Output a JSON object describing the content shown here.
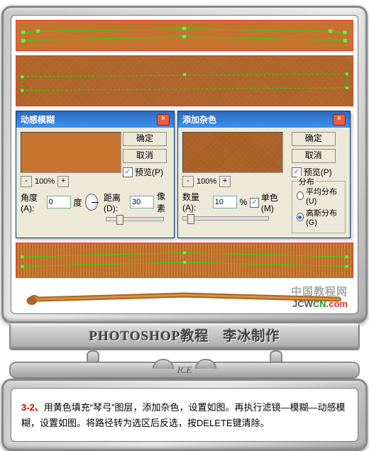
{
  "dialog1": {
    "title": "动感模糊",
    "ok": "确定",
    "cancel": "取消",
    "preview": "预览(P)",
    "zoom": "100%",
    "angle_label": "角度(A):",
    "angle_value": "0",
    "angle_unit": "度",
    "distance_label": "距离(D):",
    "distance_value": "30",
    "distance_unit": "像素"
  },
  "dialog2": {
    "title": "添加杂色",
    "ok": "确定",
    "cancel": "取消",
    "preview": "预览(P)",
    "zoom": "100%",
    "amount_label": "数量(A):",
    "amount_value": "10",
    "amount_unit": "%",
    "mono_label": "单色(M)",
    "dist_title": "分布",
    "dist_uniform": "平均分布(U)",
    "dist_gaussian": "高斯分布(G)"
  },
  "watermark": {
    "line1": "中国教程网",
    "jc": "JCW",
    "cn": "CN",
    "dot": ".",
    "com": "com"
  },
  "plate_main": "PHOTOSHOP教程　李冰制作",
  "deco_label": "ICE",
  "instruction": {
    "step": "3-2、",
    "text1": "用黄色填充“琴弓”图层，添加杂色，设置如图。再执行滤镜—模糊—动感模",
    "text2": "糊，设置如图。将路径转为选区后反选，按DELETE键清除。"
  }
}
